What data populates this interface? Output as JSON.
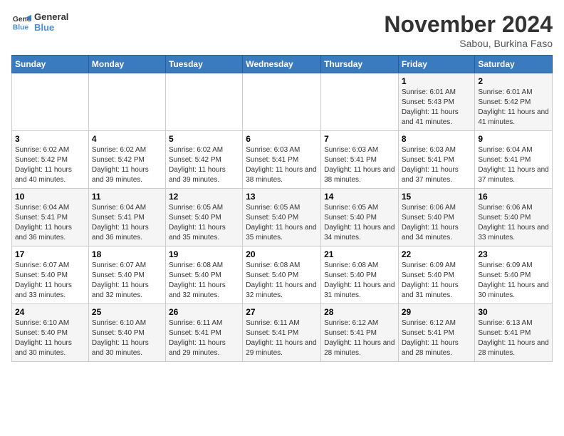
{
  "logo": {
    "line1": "General",
    "line2": "Blue"
  },
  "title": "November 2024",
  "subtitle": "Sabou, Burkina Faso",
  "days_header": [
    "Sunday",
    "Monday",
    "Tuesday",
    "Wednesday",
    "Thursday",
    "Friday",
    "Saturday"
  ],
  "weeks": [
    [
      {
        "day": "",
        "info": ""
      },
      {
        "day": "",
        "info": ""
      },
      {
        "day": "",
        "info": ""
      },
      {
        "day": "",
        "info": ""
      },
      {
        "day": "",
        "info": ""
      },
      {
        "day": "1",
        "info": "Sunrise: 6:01 AM\nSunset: 5:43 PM\nDaylight: 11 hours and 41 minutes."
      },
      {
        "day": "2",
        "info": "Sunrise: 6:01 AM\nSunset: 5:42 PM\nDaylight: 11 hours and 41 minutes."
      }
    ],
    [
      {
        "day": "3",
        "info": "Sunrise: 6:02 AM\nSunset: 5:42 PM\nDaylight: 11 hours and 40 minutes."
      },
      {
        "day": "4",
        "info": "Sunrise: 6:02 AM\nSunset: 5:42 PM\nDaylight: 11 hours and 39 minutes."
      },
      {
        "day": "5",
        "info": "Sunrise: 6:02 AM\nSunset: 5:42 PM\nDaylight: 11 hours and 39 minutes."
      },
      {
        "day": "6",
        "info": "Sunrise: 6:03 AM\nSunset: 5:41 PM\nDaylight: 11 hours and 38 minutes."
      },
      {
        "day": "7",
        "info": "Sunrise: 6:03 AM\nSunset: 5:41 PM\nDaylight: 11 hours and 38 minutes."
      },
      {
        "day": "8",
        "info": "Sunrise: 6:03 AM\nSunset: 5:41 PM\nDaylight: 11 hours and 37 minutes."
      },
      {
        "day": "9",
        "info": "Sunrise: 6:04 AM\nSunset: 5:41 PM\nDaylight: 11 hours and 37 minutes."
      }
    ],
    [
      {
        "day": "10",
        "info": "Sunrise: 6:04 AM\nSunset: 5:41 PM\nDaylight: 11 hours and 36 minutes."
      },
      {
        "day": "11",
        "info": "Sunrise: 6:04 AM\nSunset: 5:41 PM\nDaylight: 11 hours and 36 minutes."
      },
      {
        "day": "12",
        "info": "Sunrise: 6:05 AM\nSunset: 5:40 PM\nDaylight: 11 hours and 35 minutes."
      },
      {
        "day": "13",
        "info": "Sunrise: 6:05 AM\nSunset: 5:40 PM\nDaylight: 11 hours and 35 minutes."
      },
      {
        "day": "14",
        "info": "Sunrise: 6:05 AM\nSunset: 5:40 PM\nDaylight: 11 hours and 34 minutes."
      },
      {
        "day": "15",
        "info": "Sunrise: 6:06 AM\nSunset: 5:40 PM\nDaylight: 11 hours and 34 minutes."
      },
      {
        "day": "16",
        "info": "Sunrise: 6:06 AM\nSunset: 5:40 PM\nDaylight: 11 hours and 33 minutes."
      }
    ],
    [
      {
        "day": "17",
        "info": "Sunrise: 6:07 AM\nSunset: 5:40 PM\nDaylight: 11 hours and 33 minutes."
      },
      {
        "day": "18",
        "info": "Sunrise: 6:07 AM\nSunset: 5:40 PM\nDaylight: 11 hours and 32 minutes."
      },
      {
        "day": "19",
        "info": "Sunrise: 6:08 AM\nSunset: 5:40 PM\nDaylight: 11 hours and 32 minutes."
      },
      {
        "day": "20",
        "info": "Sunrise: 6:08 AM\nSunset: 5:40 PM\nDaylight: 11 hours and 32 minutes."
      },
      {
        "day": "21",
        "info": "Sunrise: 6:08 AM\nSunset: 5:40 PM\nDaylight: 11 hours and 31 minutes."
      },
      {
        "day": "22",
        "info": "Sunrise: 6:09 AM\nSunset: 5:40 PM\nDaylight: 11 hours and 31 minutes."
      },
      {
        "day": "23",
        "info": "Sunrise: 6:09 AM\nSunset: 5:40 PM\nDaylight: 11 hours and 30 minutes."
      }
    ],
    [
      {
        "day": "24",
        "info": "Sunrise: 6:10 AM\nSunset: 5:40 PM\nDaylight: 11 hours and 30 minutes."
      },
      {
        "day": "25",
        "info": "Sunrise: 6:10 AM\nSunset: 5:40 PM\nDaylight: 11 hours and 30 minutes."
      },
      {
        "day": "26",
        "info": "Sunrise: 6:11 AM\nSunset: 5:41 PM\nDaylight: 11 hours and 29 minutes."
      },
      {
        "day": "27",
        "info": "Sunrise: 6:11 AM\nSunset: 5:41 PM\nDaylight: 11 hours and 29 minutes."
      },
      {
        "day": "28",
        "info": "Sunrise: 6:12 AM\nSunset: 5:41 PM\nDaylight: 11 hours and 28 minutes."
      },
      {
        "day": "29",
        "info": "Sunrise: 6:12 AM\nSunset: 5:41 PM\nDaylight: 11 hours and 28 minutes."
      },
      {
        "day": "30",
        "info": "Sunrise: 6:13 AM\nSunset: 5:41 PM\nDaylight: 11 hours and 28 minutes."
      }
    ]
  ]
}
